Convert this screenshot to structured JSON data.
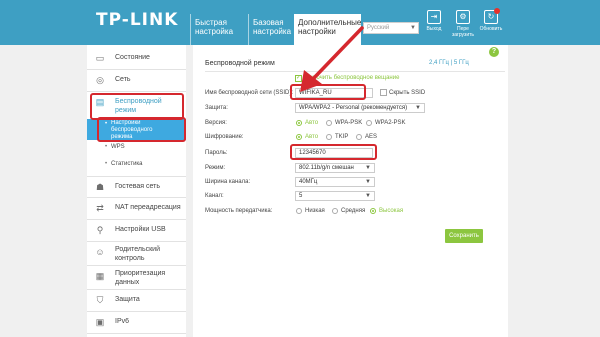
{
  "header": {
    "logo": "TP-LINK",
    "tabs": [
      {
        "line1": "Быстрая",
        "line2": "настройка"
      },
      {
        "line1": "Базовая",
        "line2": "настройка"
      },
      {
        "line1": "Дополнительные",
        "line2": "настройки"
      }
    ],
    "language": "Русский",
    "icons": [
      {
        "label": "Выход",
        "icon": "logout-icon"
      },
      {
        "label": "Пере",
        "label2": "загрузить",
        "icon": "reboot-icon"
      },
      {
        "label": "Обновить",
        "icon": "update-icon"
      }
    ]
  },
  "sidebar": {
    "items": [
      {
        "label": "Состояние",
        "icon": "status-icon"
      },
      {
        "label": "Сеть",
        "icon": "globe-icon"
      },
      {
        "label": "Беспроводной",
        "label2": "режим",
        "icon": "wifi-icon"
      },
      {
        "label": "Гостевая сеть",
        "icon": "guest-icon"
      },
      {
        "label": "NAT переадресация",
        "icon": "nat-icon"
      },
      {
        "label": "Настройки USB",
        "icon": "usb-icon"
      },
      {
        "label": "Родительский",
        "label2": "контроль",
        "icon": "parental-icon"
      },
      {
        "label": "Приоритезация",
        "label2": "данных",
        "icon": "qos-icon"
      },
      {
        "label": "Защита",
        "icon": "shield-icon"
      },
      {
        "label": "IPv6",
        "icon": "ipv6-icon"
      }
    ],
    "subitems": [
      {
        "line1": "Настройки",
        "line2": "беспроводного",
        "line3": "режима"
      },
      {
        "line1": "WPS"
      },
      {
        "line1": "Статистика"
      }
    ]
  },
  "content": {
    "title": "Беспроводной режим",
    "band": "2,4 ГГц  |  5 ГГц",
    "enable_label": "Включить беспроводное вещание",
    "ssid_label": "Имя беспроводной сети (SSID):",
    "ssid_value": "WIFIKA_RU",
    "hide_ssid_label": "Скрыть SSID",
    "security_label": "Защита:",
    "security_value": "WPA/WPA2 - Personal (рекомендуется)",
    "version_label": "Версия:",
    "version_options": [
      "Авто",
      "WPA-PSK",
      "WPA2-PSK"
    ],
    "encryption_label": "Шифрование:",
    "encryption_options": [
      "Авто",
      "TKIP",
      "AES"
    ],
    "password_label": "Пароль:",
    "password_value": "12345670",
    "mode_label": "Режим:",
    "mode_value": "802.11b/g/n смешан",
    "width_label": "Ширина канала:",
    "width_value": "40МГц",
    "channel_label": "Канал:",
    "channel_value": "5",
    "power_label": "Мощность передатчика:",
    "power_options": [
      "Низкая",
      "Средняя",
      "Высокая"
    ],
    "save_label": "Сохранить"
  },
  "colors": {
    "accent": "#3e9fc3",
    "green": "#8cc63f",
    "highlight": "#d5282e"
  }
}
